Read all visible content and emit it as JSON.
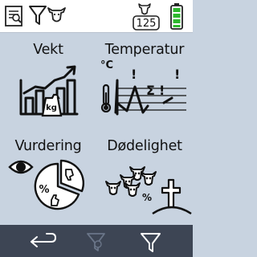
{
  "header": {
    "icons": [
      "report-icon",
      "filter-animal-icon",
      "herd-count-icon",
      "battery-icon"
    ],
    "animal_count": "125"
  },
  "tiles": [
    {
      "label": "Vekt",
      "icon": "weight-chart-icon"
    },
    {
      "label": "Temperatur",
      "icon": "temperature-chart-icon",
      "unit": "°C",
      "chart_symbols": [
        "!",
        "Σ",
        "!"
      ]
    },
    {
      "label": "Vurdering",
      "icon": "evaluation-pie-icon",
      "pie_symbol": "%"
    },
    {
      "label": "Dødelighet",
      "icon": "mortality-icon",
      "pie_symbol": "%"
    }
  ],
  "weight_box_text": "kg",
  "footer": {
    "buttons": [
      "back-button",
      "filter-disabled-button",
      "filter-button"
    ]
  },
  "colors": {
    "background": "#c8d3e0",
    "topbar": "#ffffff",
    "bottombar": "#3d4554",
    "battery_green": "#2eb82e"
  }
}
